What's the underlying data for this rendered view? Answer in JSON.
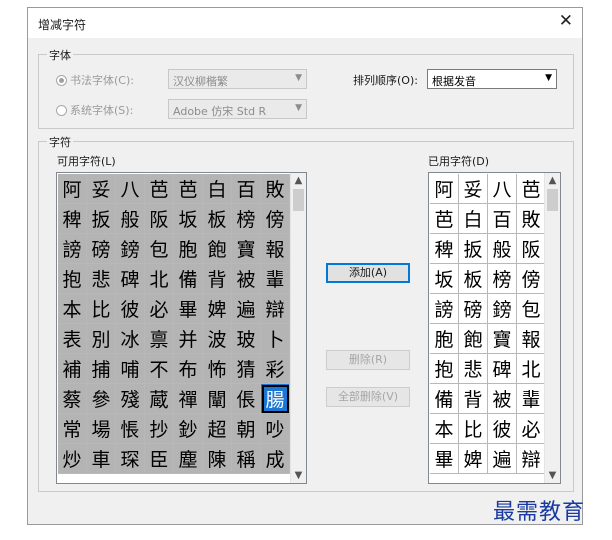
{
  "dialog": {
    "title": "增减字符",
    "close": "✕"
  },
  "font_group": {
    "label": "字体",
    "calligraphy_label": "书法字体(C):",
    "calligraphy_value": "汉仪柳楷繁",
    "system_label": "系统字体(S):",
    "system_value": "Adobe 仿宋 Std R",
    "sort_label": "排列顺序(O):",
    "sort_value": "根据发音"
  },
  "chars_group": {
    "label": "字符",
    "available_label": "可用字符(L)",
    "used_label": "已用字符(D)",
    "available_rows": [
      [
        "阿",
        "妥",
        "八",
        "芭",
        "芭",
        "白",
        "百",
        "敗"
      ],
      [
        "稗",
        "扳",
        "般",
        "阪",
        "坂",
        "板",
        "榜",
        "傍"
      ],
      [
        "謗",
        "磅",
        "鎊",
        "包",
        "胞",
        "飽",
        "寶",
        "報"
      ],
      [
        "抱",
        "悲",
        "碑",
        "北",
        "備",
        "背",
        "被",
        "輩"
      ],
      [
        "本",
        "比",
        "彼",
        "必",
        "畢",
        "婢",
        "遍",
        "辯"
      ],
      [
        "表",
        "別",
        "冰",
        "禀",
        "并",
        "波",
        "玻",
        "卜"
      ],
      [
        "補",
        "捕",
        "哺",
        "不",
        "布",
        "怖",
        "猜",
        "彩"
      ],
      [
        "蔡",
        "參",
        "殘",
        "蔵",
        "禪",
        "闡",
        "倀",
        "腸"
      ],
      [
        "常",
        "場",
        "悵",
        "抄",
        "鈔",
        "超",
        "朝",
        "吵"
      ],
      [
        "炒",
        "車",
        "琛",
        "臣",
        "塵",
        "陳",
        "稱",
        "成"
      ]
    ],
    "used_rows": [
      [
        "阿",
        "妥",
        "八",
        "芭"
      ],
      [
        "芭",
        "白",
        "百",
        "敗"
      ],
      [
        "稗",
        "扳",
        "般",
        "阪"
      ],
      [
        "坂",
        "板",
        "榜",
        "傍"
      ],
      [
        "謗",
        "磅",
        "鎊",
        "包"
      ],
      [
        "胞",
        "飽",
        "寶",
        "報"
      ],
      [
        "抱",
        "悲",
        "碑",
        "北"
      ],
      [
        "備",
        "背",
        "被",
        "輩"
      ],
      [
        "本",
        "比",
        "彼",
        "必"
      ],
      [
        "畢",
        "婢",
        "遍",
        "辯"
      ]
    ],
    "add_button": "添加(A)",
    "remove_button": "删除(R)",
    "remove_all_button": "全部删除(V)"
  },
  "watermark": "最需教育"
}
